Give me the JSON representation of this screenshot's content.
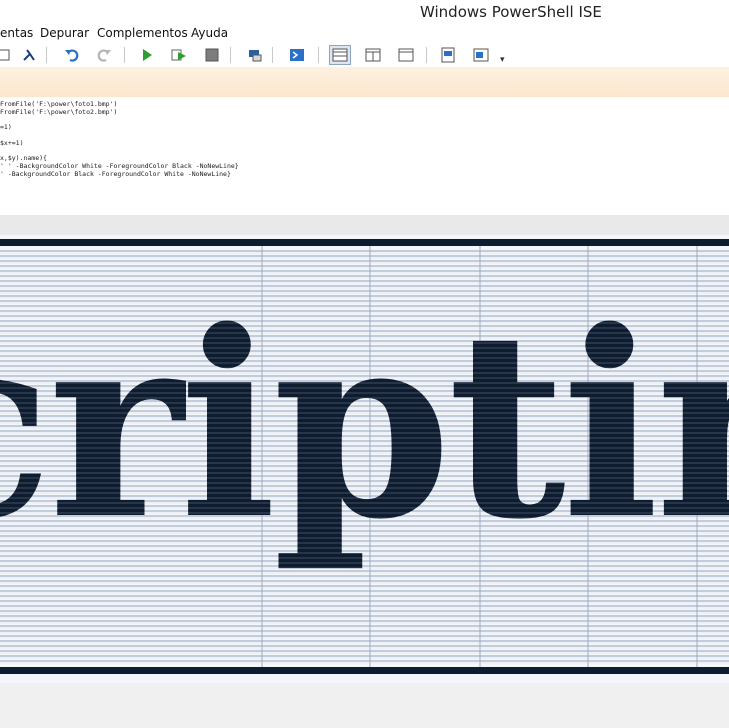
{
  "window": {
    "title": "Windows PowerShell ISE"
  },
  "menu": [
    "entas",
    "Depurar",
    "Complementos",
    "Ayuda"
  ],
  "toolbar": [
    {
      "icon": "open-icon"
    },
    {
      "icon": "powershell-prompt-icon"
    },
    {
      "icon": "undo-icon"
    },
    {
      "icon": "redo-icon"
    },
    {
      "icon": "run-script-icon"
    },
    {
      "icon": "run-selection-icon"
    },
    {
      "icon": "stop-icon"
    },
    {
      "icon": "remote-powershell-icon"
    },
    {
      "icon": "powershell-console-icon"
    },
    {
      "icon": "show-script-pane-top-icon"
    },
    {
      "icon": "show-script-pane-right-icon"
    },
    {
      "icon": "show-script-pane-maximized-icon"
    },
    {
      "icon": "show-command-window-icon"
    },
    {
      "icon": "show-command-addon-icon"
    }
  ],
  "editor": {
    "lines": [
      "FromFile('F:\\power\\foto1.bmp')",
      "FromFile('F:\\power\\foto2.bmp')",
      "=1)",
      "$x+=1)",
      "x,$y).name){",
      "' ' -BackgroundColor White -ForegroundColor Black -NoNewLine}",
      "' -BackgroundColor Black -ForegroundColor White -NoNewLine}"
    ]
  },
  "console": {
    "ascii_art_text": "Scripting"
  },
  "colors": {
    "accent": "#0e1c30",
    "tab_strip": "#fbe7cd",
    "console_bg": "#f4f6fa"
  }
}
